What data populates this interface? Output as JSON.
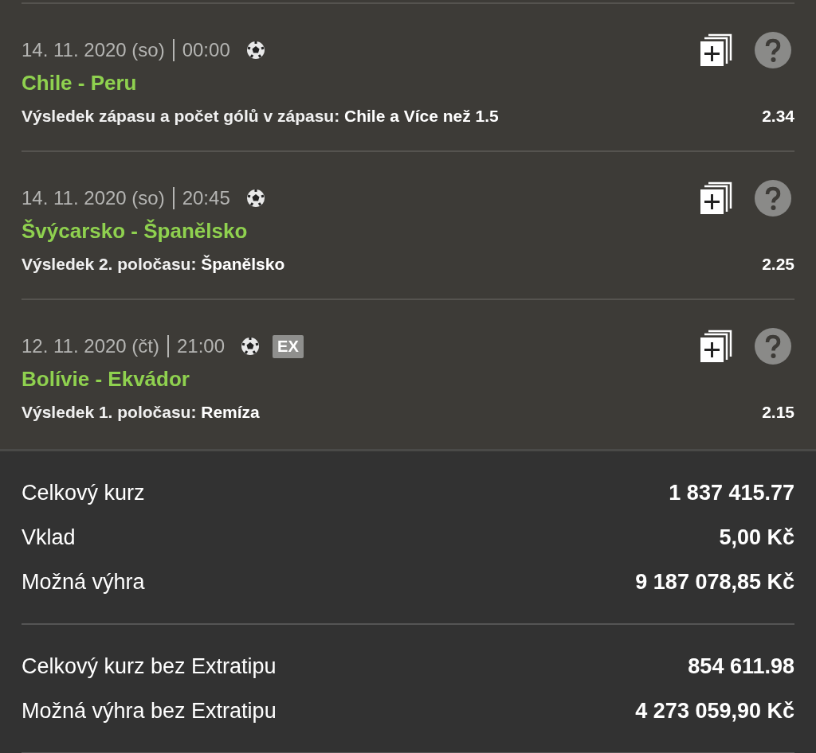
{
  "bets": [
    {
      "date": "14. 11. 2020 (so)",
      "time": "00:00",
      "extratip": false,
      "match": "Chile - Peru",
      "market": "Výsledek zápasu a počet gólů v zápasu:",
      "selection": "Chile a Více než 1.5",
      "odds": "2.34"
    },
    {
      "date": "14. 11. 2020 (so)",
      "time": "20:45",
      "extratip": false,
      "match": "Švýcarsko - Španělsko",
      "market": "Výsledek 2. poločasu:",
      "selection": "Španělsko",
      "odds": "2.25"
    },
    {
      "date": "12. 11. 2020 (čt)",
      "time": "21:00",
      "extratip": true,
      "extratip_label": "EX",
      "match": "Bolívie - Ekvádor",
      "market": "Výsledek 1. poločasu:",
      "selection": "Remíza",
      "odds": "2.15"
    }
  ],
  "summary": [
    {
      "label": "Celkový kurz",
      "value": "1 837 415.77"
    },
    {
      "label": "Vklad",
      "value": "5,00 Kč"
    },
    {
      "label": "Možná výhra",
      "value": "9 187 078,85 Kč"
    }
  ],
  "summary_without_extratip": [
    {
      "label": "Celkový kurz bez Extratipu",
      "value": "854 611.98"
    },
    {
      "label": "Možná výhra bez Extratipu",
      "value": "4 273 059,90 Kč"
    }
  ]
}
